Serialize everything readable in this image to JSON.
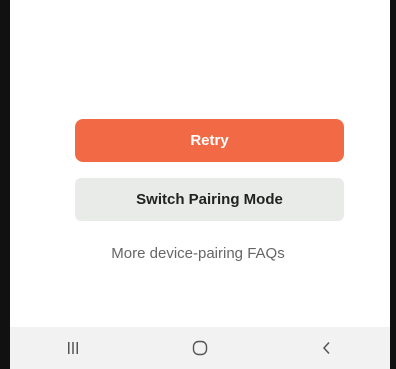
{
  "actions": {
    "retry_label": "Retry",
    "switch_label": "Switch Pairing Mode",
    "faq_link": "More device-pairing FAQs"
  },
  "colors": {
    "accent": "#f26a45",
    "secondary_button": "#e9ebe9",
    "link_text": "#666666"
  },
  "navbar": {
    "items": [
      {
        "icon": "recent-apps-icon"
      },
      {
        "icon": "home-icon"
      },
      {
        "icon": "back-icon"
      }
    ]
  }
}
